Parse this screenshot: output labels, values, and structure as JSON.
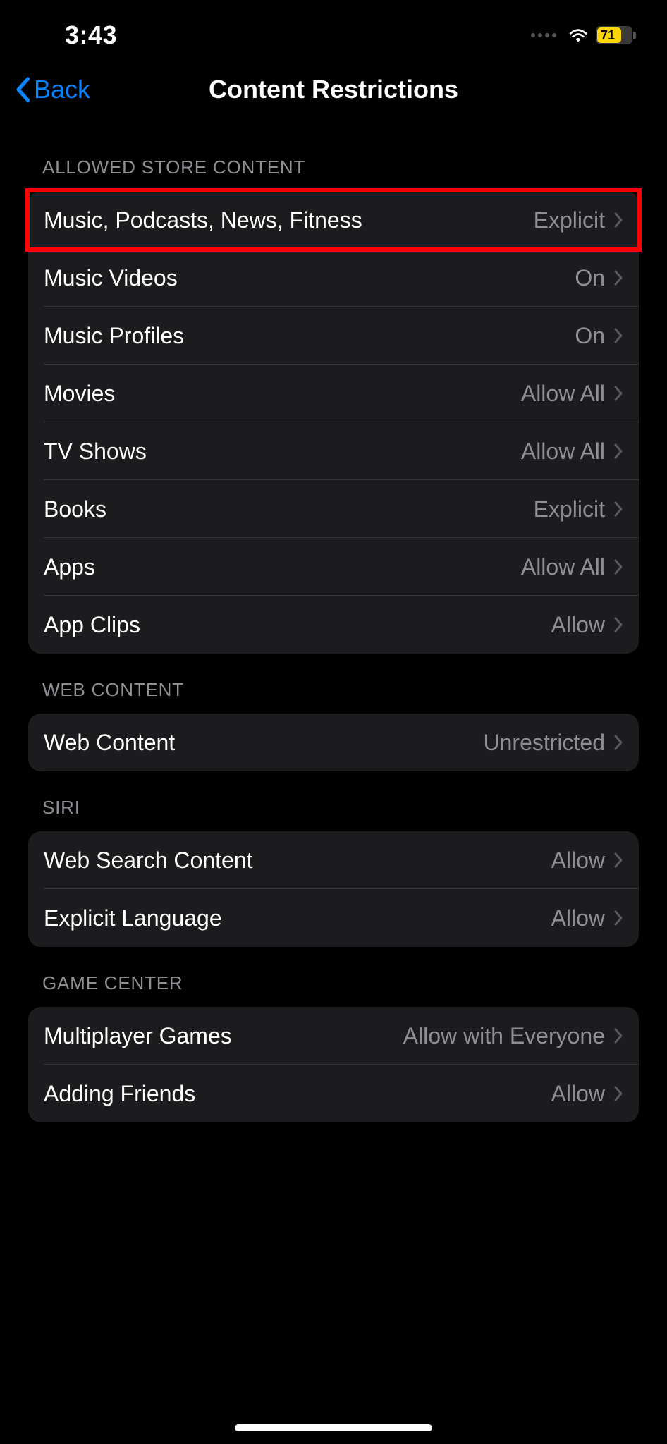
{
  "status": {
    "time": "3:43",
    "battery": "71"
  },
  "nav": {
    "back": "Back",
    "title": "Content Restrictions"
  },
  "sections": [
    {
      "header": "ALLOWED STORE CONTENT",
      "rows": [
        {
          "label": "Music, Podcasts, News, Fitness",
          "value": "Explicit",
          "highlight": true
        },
        {
          "label": "Music Videos",
          "value": "On"
        },
        {
          "label": "Music Profiles",
          "value": "On"
        },
        {
          "label": "Movies",
          "value": "Allow All"
        },
        {
          "label": "TV Shows",
          "value": "Allow All"
        },
        {
          "label": "Books",
          "value": "Explicit"
        },
        {
          "label": "Apps",
          "value": "Allow All"
        },
        {
          "label": "App Clips",
          "value": "Allow"
        }
      ]
    },
    {
      "header": "WEB CONTENT",
      "rows": [
        {
          "label": "Web Content",
          "value": "Unrestricted"
        }
      ]
    },
    {
      "header": "SIRI",
      "rows": [
        {
          "label": "Web Search Content",
          "value": "Allow"
        },
        {
          "label": "Explicit Language",
          "value": "Allow"
        }
      ]
    },
    {
      "header": "GAME CENTER",
      "rows": [
        {
          "label": "Multiplayer Games",
          "value": "Allow with Everyone"
        },
        {
          "label": "Adding Friends",
          "value": "Allow"
        }
      ]
    }
  ]
}
